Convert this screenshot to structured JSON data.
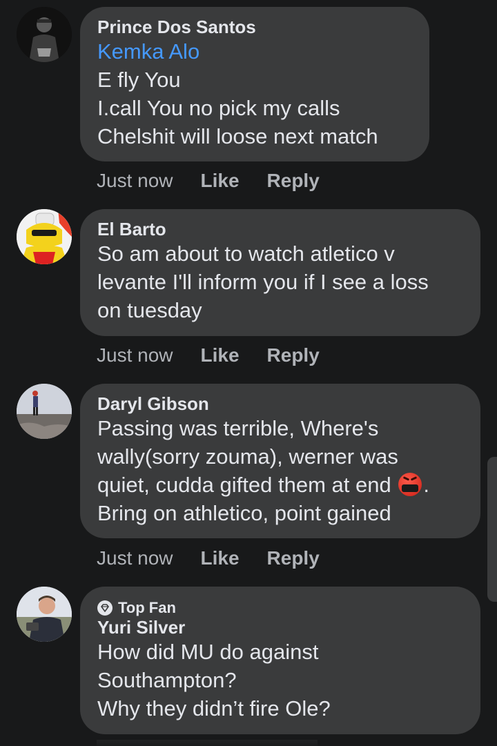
{
  "comments": [
    {
      "name": "Prince Dos Santos",
      "mention": "Kemka Alo",
      "lines": [
        "E fly You",
        "I.call You no pick my calls",
        "Chelshit will loose  next  match"
      ],
      "time": "Just now",
      "like": "Like",
      "reply": "Reply"
    },
    {
      "name": "El Barto",
      "lines": [
        "So am about to watch atletico v",
        "levante I'll inform you if I see a loss",
        "on tuesday"
      ],
      "time": "Just now",
      "like": "Like",
      "reply": "Reply"
    },
    {
      "name": "Daryl Gibson",
      "lines": [
        "Passing was terrible, Where's",
        "wally(sorry zouma), werner was",
        "quiet, cudda gifted them at end",
        "Bring on athletico, point gained"
      ],
      "line3_suffix": ".",
      "emoji": "cursing-face-emoji",
      "time": "Just now",
      "like": "Like",
      "reply": "Reply"
    },
    {
      "badge": "Top Fan",
      "name": "Yuri Silver",
      "lines": [
        "How did MU do against",
        "Southampton?",
        "Why they didn’t fire Ole?"
      ]
    }
  ],
  "colors": {
    "background": "#18191a",
    "bubble": "#3a3b3c",
    "mention": "#4599ff",
    "secondary_text": "#b0b3b8"
  }
}
